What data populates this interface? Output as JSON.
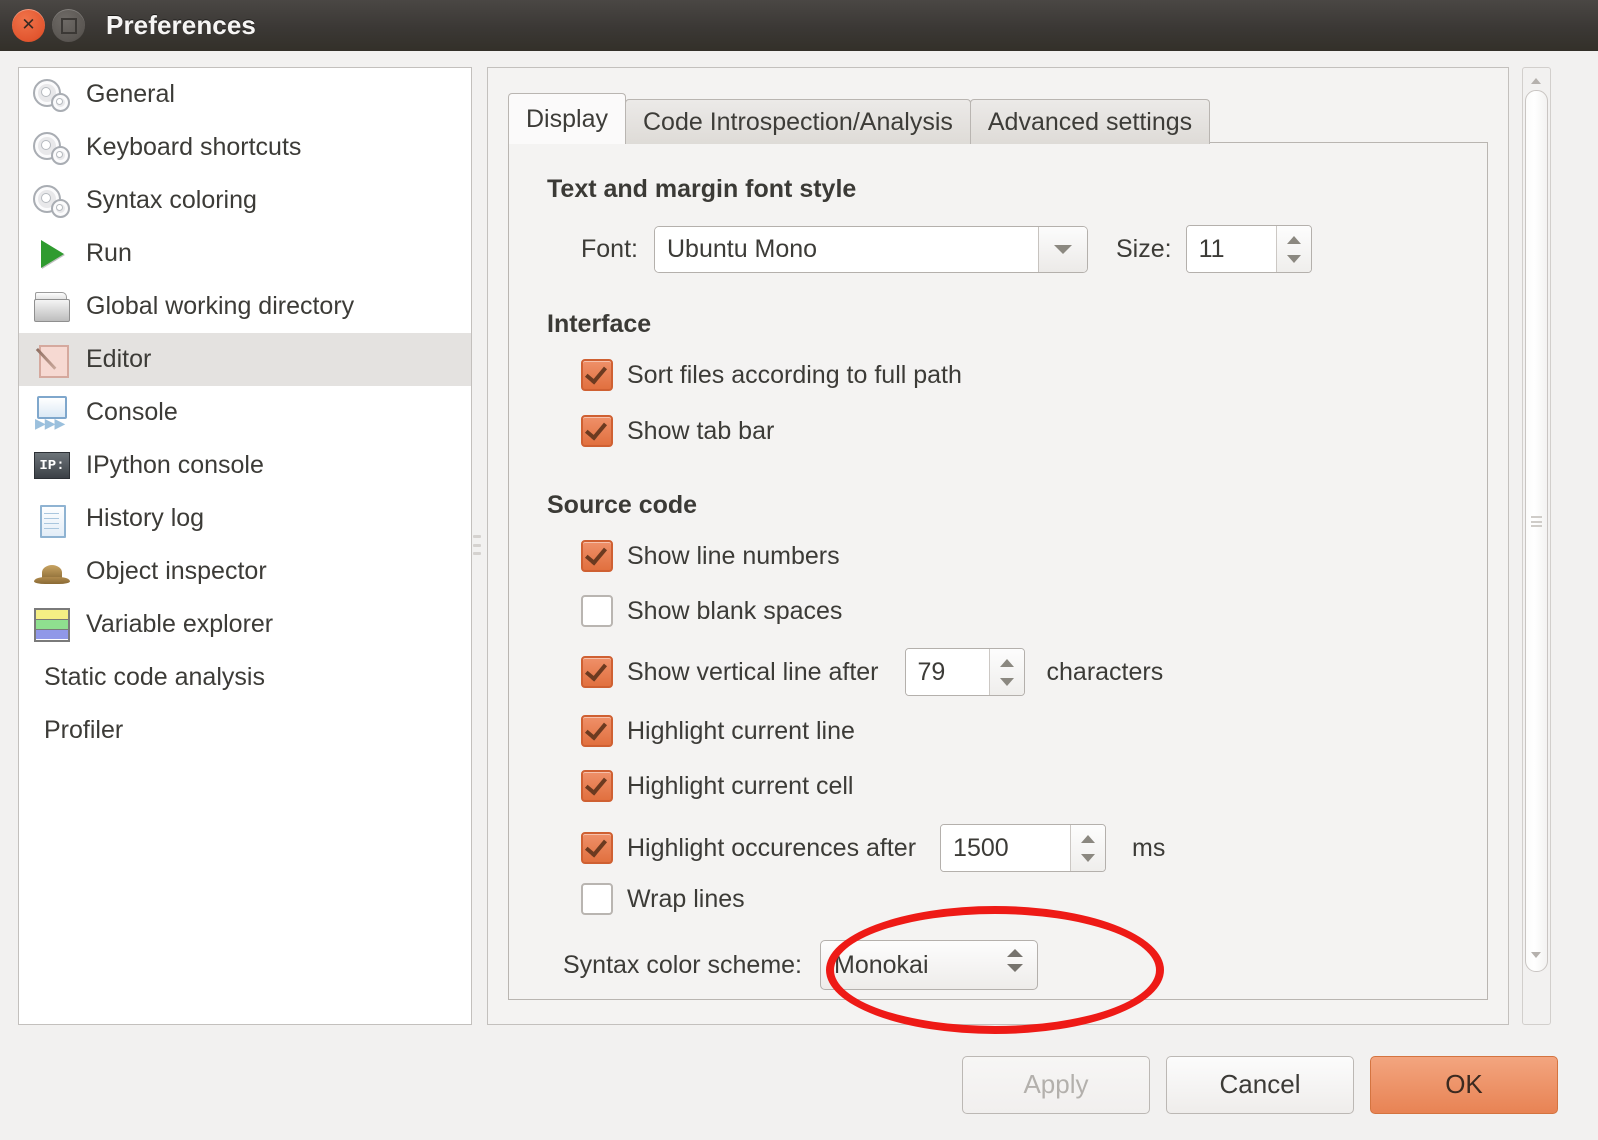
{
  "window": {
    "title": "Preferences",
    "close_icon": "close-icon",
    "maximize_icon": "maximize-icon"
  },
  "sidebar": {
    "items": [
      {
        "label": "General",
        "icon": "gear-icon",
        "selected": false
      },
      {
        "label": "Keyboard shortcuts",
        "icon": "gear-icon",
        "selected": false
      },
      {
        "label": "Syntax coloring",
        "icon": "gear-icon",
        "selected": false
      },
      {
        "label": "Run",
        "icon": "play-triangle-icon",
        "selected": false
      },
      {
        "label": "Global working directory",
        "icon": "folder-icon",
        "selected": false
      },
      {
        "label": "Editor",
        "icon": "editor-pencil-icon",
        "selected": true
      },
      {
        "label": "Console",
        "icon": "console-icon",
        "selected": false
      },
      {
        "label": "IPython console",
        "icon": "ipython-icon",
        "selected": false
      },
      {
        "label": "History log",
        "icon": "notepad-icon",
        "selected": false
      },
      {
        "label": "Object inspector",
        "icon": "hat-icon",
        "selected": false
      },
      {
        "label": "Variable explorer",
        "icon": "color-bars-icon",
        "selected": false
      },
      {
        "label": "Static code analysis",
        "icon": "none",
        "selected": false
      },
      {
        "label": "Profiler",
        "icon": "none",
        "selected": false
      }
    ]
  },
  "tabs": [
    {
      "label": "Display",
      "active": true
    },
    {
      "label": "Code Introspection/Analysis",
      "active": false
    },
    {
      "label": "Advanced settings",
      "active": false
    }
  ],
  "display_tab": {
    "font_section": {
      "title": "Text and margin font style",
      "font_label": "Font:",
      "font_value": "Ubuntu Mono",
      "size_label": "Size:",
      "size_value": "11"
    },
    "interface_section": {
      "title": "Interface",
      "checkboxes": [
        {
          "label": "Sort files according to full path",
          "checked": true
        },
        {
          "label": "Show tab bar",
          "checked": true
        }
      ]
    },
    "source_code_section": {
      "title": "Source code",
      "show_line_numbers": {
        "label": "Show line numbers",
        "checked": true
      },
      "show_blank_spaces": {
        "label": "Show blank spaces",
        "checked": false
      },
      "vertical_line": {
        "label": "Show vertical line after",
        "checked": true,
        "value": "79",
        "suffix": "characters"
      },
      "highlight_current_line": {
        "label": "Highlight current line",
        "checked": true
      },
      "highlight_current_cell": {
        "label": "Highlight current cell",
        "checked": true
      },
      "highlight_occurrences": {
        "label": "Highlight occurences after",
        "checked": true,
        "value": "1500",
        "suffix": "ms"
      },
      "wrap_lines": {
        "label": "Wrap lines",
        "checked": false
      },
      "syntax_color_scheme": {
        "label": "Syntax color scheme:",
        "value": "Monokai"
      }
    }
  },
  "buttons": {
    "apply": "Apply",
    "cancel": "Cancel",
    "ok": "OK"
  },
  "annotation": {
    "shape": "ellipse",
    "color": "#ee1a16",
    "target": "syntax-color-scheme-combobox"
  },
  "colors": {
    "accent_orange": "#e1703f",
    "titlebar": "#3b3835",
    "panel_bg": "#f4f3f2",
    "selected_row": "#e4e2e0",
    "annotation_red": "#ee1a16"
  }
}
